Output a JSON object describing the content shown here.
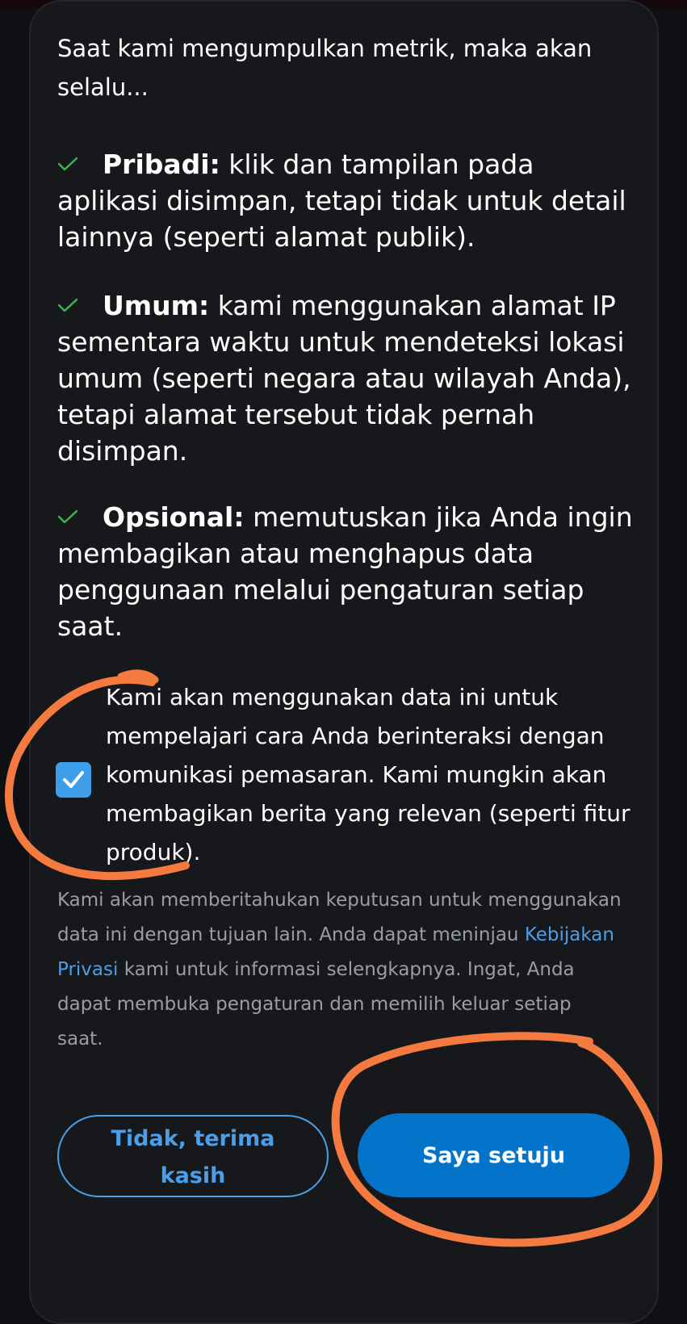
{
  "intro": "Saat kami mengumpulkan metrik, maka akan selalu...",
  "points": [
    {
      "icon": "check-icon",
      "title": "Pribadi:",
      "text": " klik dan tampilan pada aplikasi disimpan, tetapi tidak untuk detail lainnya (seperti alamat publik)."
    },
    {
      "icon": "check-icon",
      "title": "Umum:",
      "text": " kami menggunakan alamat IP sementara waktu untuk mendeteksi lokasi umum (seperti negara atau wilayah Anda), tetapi alamat tersebut tidak pernah disimpan."
    },
    {
      "icon": "check-icon",
      "title": "Opsional:",
      "text": " memutuskan jika Anda ingin membagikan atau menghapus data penggunaan melalui pengaturan setiap saat."
    }
  ],
  "consent": {
    "checked": true,
    "text": "Kami akan menggunakan data ini untuk mempelajari cara Anda berinteraksi dengan komunikasi pemasaran. Kami mungkin akan membagikan berita yang relevan (seperti fitur produk)."
  },
  "notice": {
    "before": "Kami akan memberitahukan keputusan untuk menggunakan data ini dengan tujuan lain. Anda dapat meninjau ",
    "link": "Kebijakan Privasi",
    "after": " kami untuk informasi selengkapnya. Ingat, Anda dapat membuka pengaturan dan memilih keluar setiap saat."
  },
  "buttons": {
    "decline": "Tidak, terima kasih",
    "accept": "Saya setuju"
  },
  "colors": {
    "background": "#17181b",
    "accent": "#0374c9",
    "link": "#4a9fe8",
    "check": "#39b54a",
    "annotation": "#f47a3f"
  }
}
